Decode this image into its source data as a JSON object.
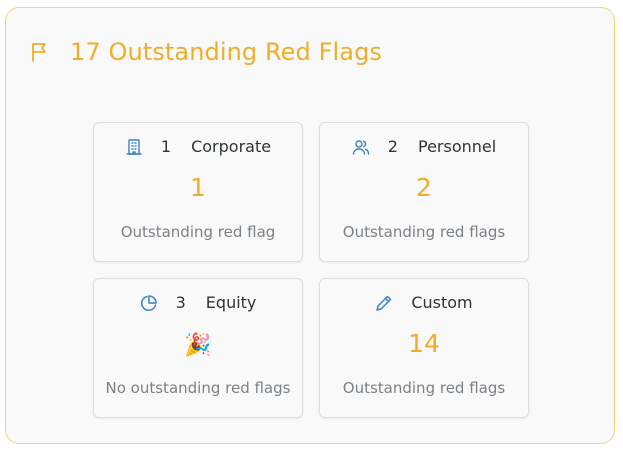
{
  "header": {
    "title": "17 Outstanding Red Flags",
    "icon": "flag-icon"
  },
  "accent_color": "#f0ad2c",
  "icon_color": "#3b82c4",
  "cards": [
    {
      "icon": "building-icon",
      "number": "1",
      "name": "Corporate",
      "count": "1",
      "subtitle": "Outstanding red flag"
    },
    {
      "icon": "users-icon",
      "number": "2",
      "name": "Personnel",
      "count": "2",
      "subtitle": "Outstanding red flags"
    },
    {
      "icon": "pie-chart-icon",
      "number": "3",
      "name": "Equity",
      "emoji": "🎉",
      "subtitle": "No outstanding red flags"
    },
    {
      "icon": "pencil-icon",
      "number": "",
      "name": "Custom",
      "count": "14",
      "subtitle": "Outstanding red flags"
    }
  ]
}
